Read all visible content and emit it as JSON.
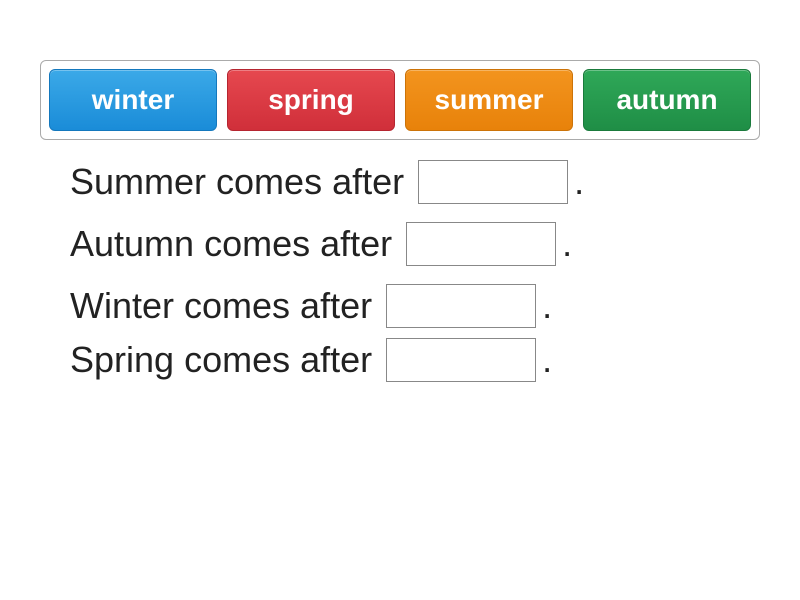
{
  "wordBank": {
    "tiles": [
      {
        "label": "winter",
        "colorClass": "tile-blue"
      },
      {
        "label": "spring",
        "colorClass": "tile-red"
      },
      {
        "label": "summer",
        "colorClass": "tile-orange"
      },
      {
        "label": "autumn",
        "colorClass": "tile-green"
      }
    ]
  },
  "sentences": [
    {
      "w1": "Summer",
      "w2": "comes",
      "w3": "after",
      "slot": "",
      "period": "."
    },
    {
      "w1": "Autumn",
      "w2": "comes",
      "w3": "after",
      "slot": "",
      "period": "."
    },
    {
      "w1": "Winter",
      "w2": "comes",
      "w3": "after",
      "slot": "",
      "period": "."
    },
    {
      "w1": "Spring",
      "w2": "comes",
      "w3": "after",
      "slot": "",
      "period": "."
    }
  ]
}
